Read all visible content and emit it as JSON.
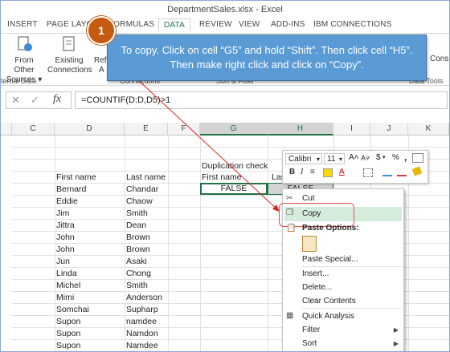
{
  "window": {
    "title": "DepartmentSales.xlsx - Excel"
  },
  "tabs": [
    {
      "label": "INSERT"
    },
    {
      "label": "PAGE LAYOUT"
    },
    {
      "label": "FORMULAS"
    },
    {
      "label": "DATA"
    },
    {
      "label": "REVIEW"
    },
    {
      "label": "VIEW"
    },
    {
      "label": "ADD-INS"
    },
    {
      "label": "IBM CONNECTIONS"
    }
  ],
  "ribbon": {
    "from_other": "From Other",
    "sources": "Sources ▾",
    "existing": "Existing",
    "connections": "Connections",
    "refresh_partial": "Refr",
    "refresh_partial2": "A",
    "group_external": "ternal Data",
    "group_connections": "Connections",
    "group_sort": "Sort & Filter",
    "group_datatools": "Data Tools",
    "cons_partial": "Cons"
  },
  "formula_bar": {
    "cancel": "✕",
    "enter": "✓",
    "fx": "fx",
    "formula": "=COUNTIF(D:D,D5)>1"
  },
  "columns": [
    "C",
    "D",
    "E",
    "F",
    "G",
    "H",
    "I",
    "J",
    "K"
  ],
  "sheet": {
    "dup_check": "Duplication check",
    "hdr_first": "First name",
    "hdr_last": "Last name",
    "g_first": "First name",
    "h_last_partial": "Las",
    "g5": "FALSE",
    "h5": "FALSE",
    "rows": [
      {
        "first": "Bernard",
        "last": "Chandar"
      },
      {
        "first": "Eddie",
        "last": "Chaow"
      },
      {
        "first": "Jim",
        "last": "Smith"
      },
      {
        "first": "Jittra",
        "last": "Dean"
      },
      {
        "first": "John",
        "last": "Brown"
      },
      {
        "first": "John",
        "last": "Brown"
      },
      {
        "first": "Jun",
        "last": "Asaki"
      },
      {
        "first": "Linda",
        "last": "Chong"
      },
      {
        "first": "Michel",
        "last": "Smith"
      },
      {
        "first": "Mimi",
        "last": "Anderson"
      },
      {
        "first": "Somchai",
        "last": "Supharp"
      },
      {
        "first": "Supon",
        "last": "namdee"
      },
      {
        "first": "Supon",
        "last": "Namdon"
      },
      {
        "first": "Supon",
        "last": "Namdee"
      }
    ]
  },
  "callout": {
    "step": "1",
    "line1": "To copy. Click on cell “G5” and hold “Shift”. Then click cell “H5”.",
    "line2": "Then make right click and click on “Copy”."
  },
  "mini_toolbar": {
    "font": "Calibri",
    "size": "11",
    "font_dd": "▾",
    "size_dd": "▾",
    "bigger": "A˄",
    "smaller": "A˅",
    "currency": "$",
    "currency_dd": "▾",
    "percent": "%",
    "comma": ",",
    "bold": "B",
    "italic": "I",
    "align": "≡",
    "font_color": "A"
  },
  "context_menu": {
    "cut": "Cut",
    "copy": "Copy",
    "paste_options": "Paste Options:",
    "paste_special": "Paste Special...",
    "insert": "Insert...",
    "delete": "Delete...",
    "clear": "Clear Contents",
    "quick_analysis": "Quick Analysis",
    "filter": "Filter",
    "sort": "Sort"
  },
  "colors": {
    "excel_green": "#217346",
    "callout_blue": "#5b9bd5",
    "badge_orange": "#c55a11",
    "copy_highlight": "#d5ecdc"
  }
}
